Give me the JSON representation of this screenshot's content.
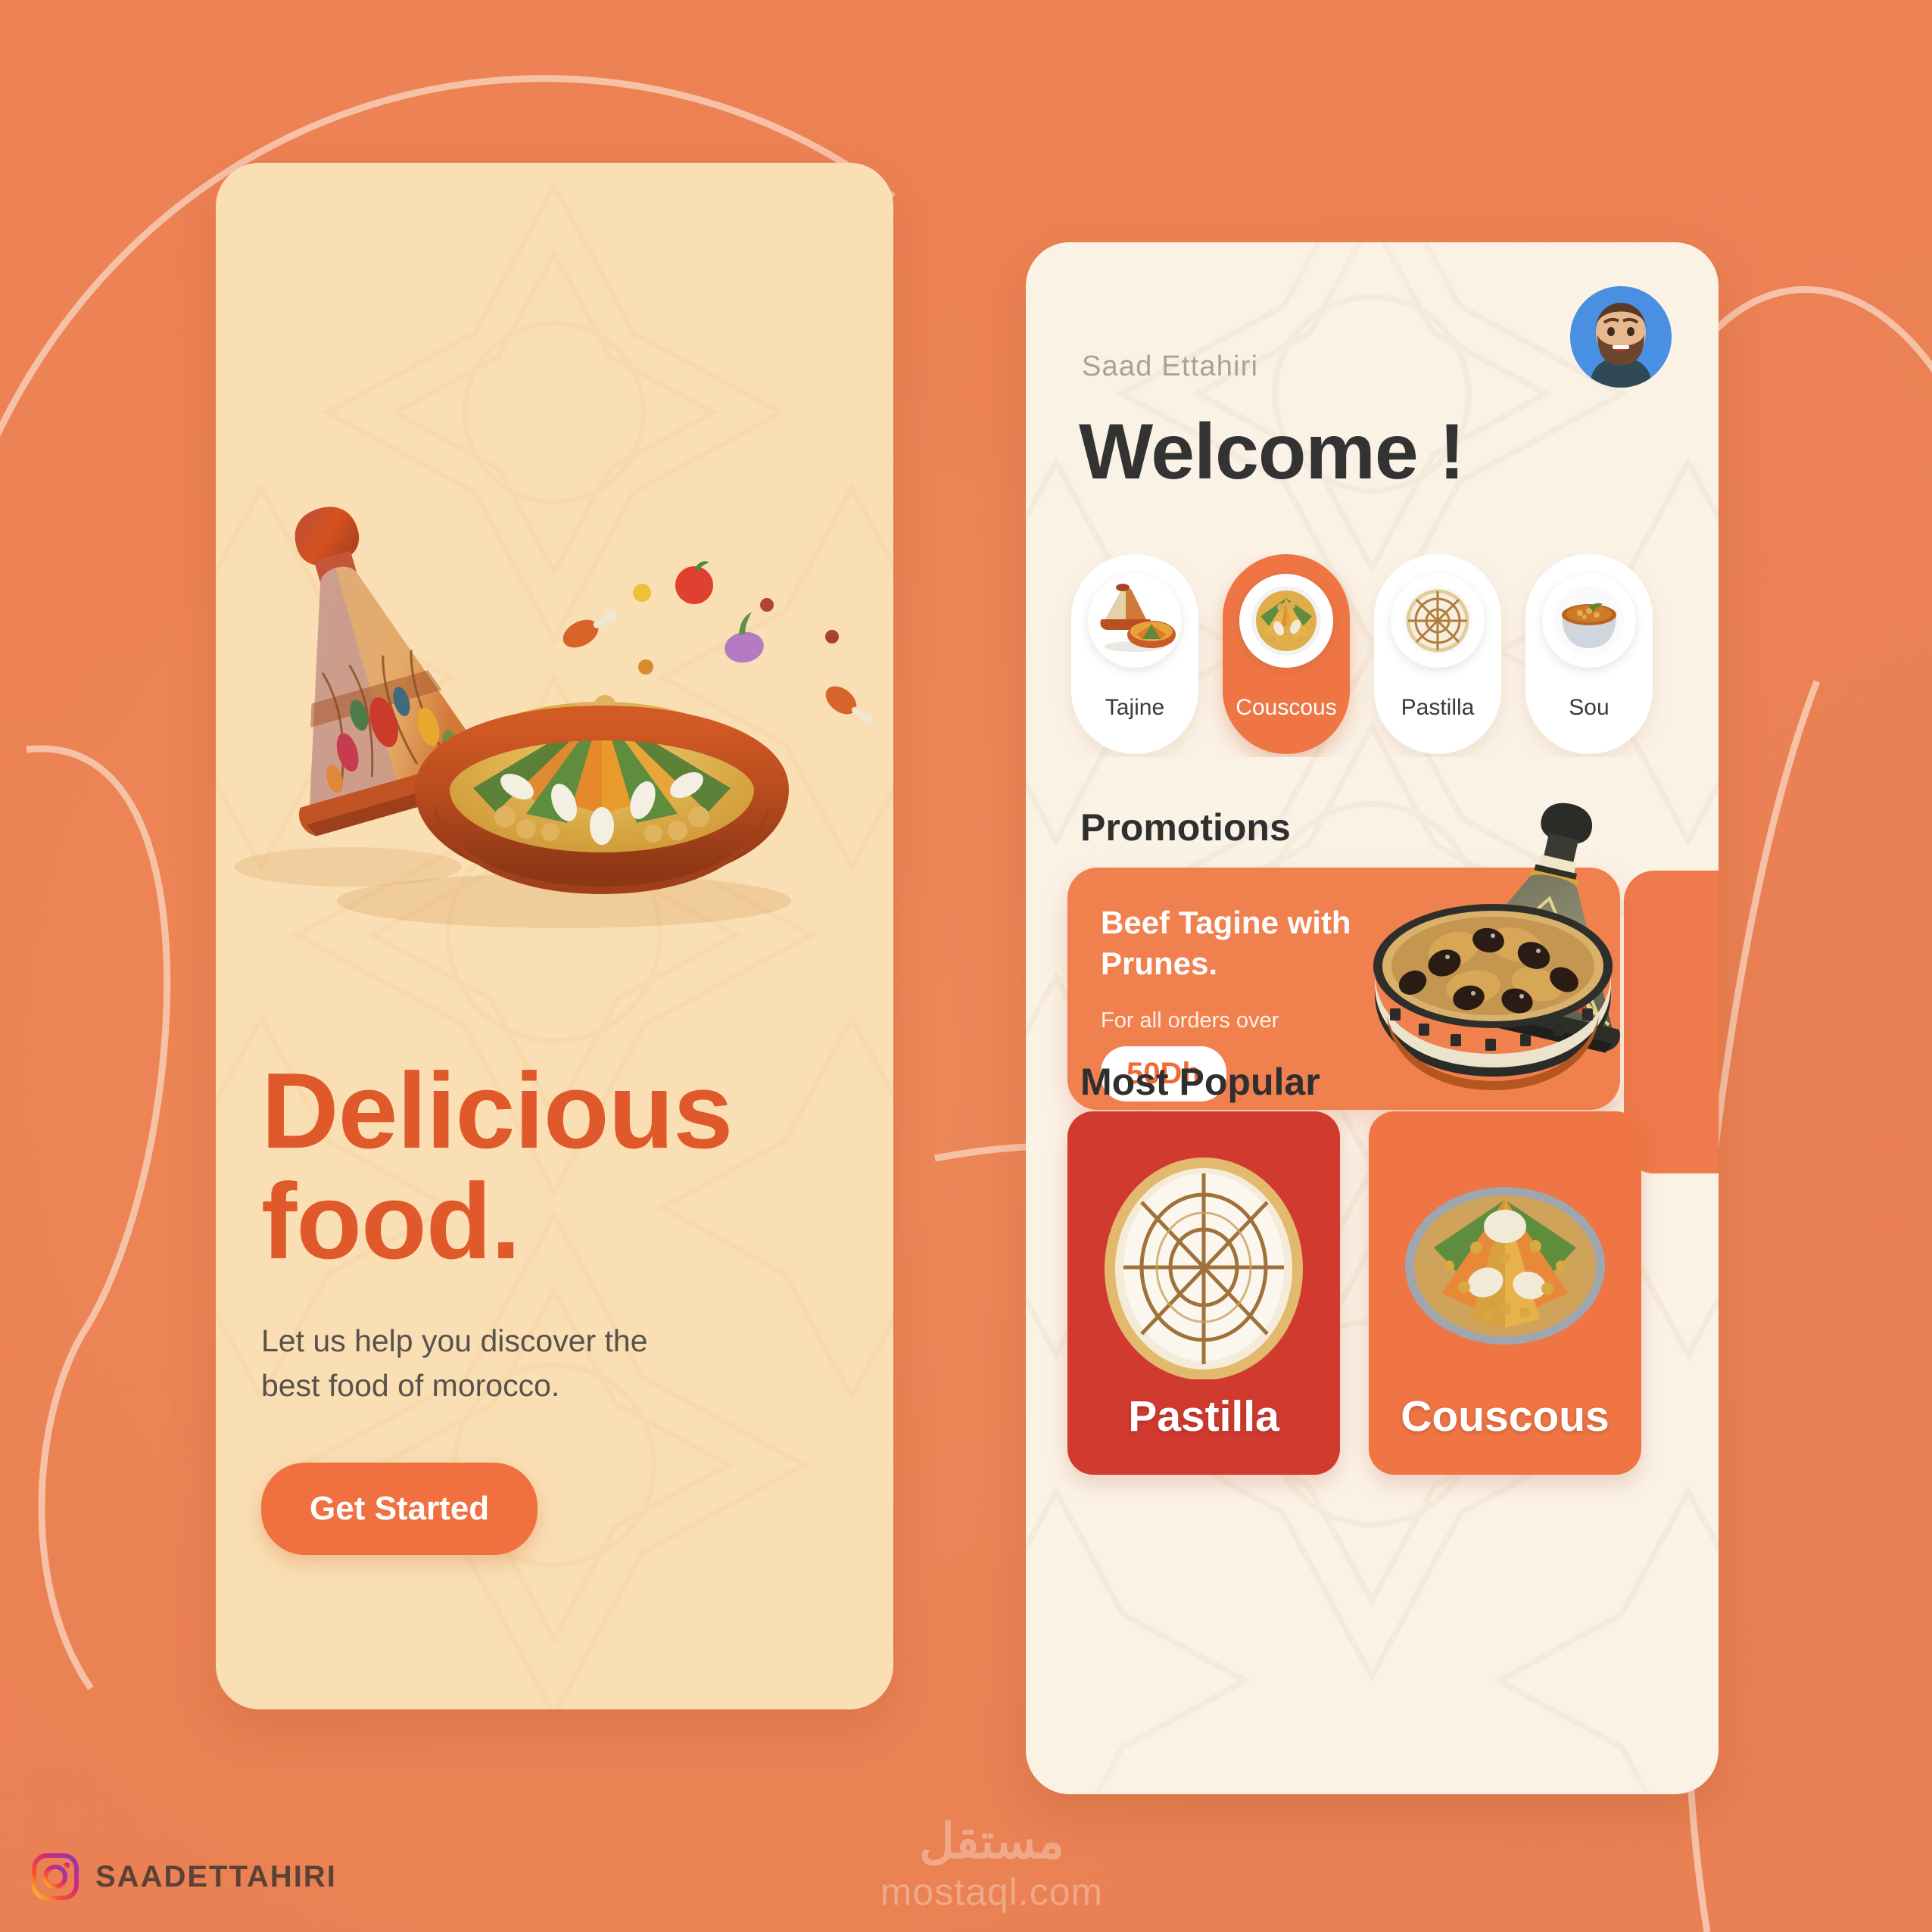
{
  "theme": {
    "background": "#ec8053",
    "accent": "#f0713f",
    "accent_dark": "#e0592a",
    "card_cream": "#fadfb4",
    "card_offwhite": "#fbf2e6",
    "pastilla_red": "#d13b2f",
    "couscous_orange": "#ef7544"
  },
  "onboarding": {
    "headline_line1": "Delicious",
    "headline_line2": "food.",
    "subcopy": "Let us help you discover the best food of morocco.",
    "cta_label": "Get Started",
    "hero_icon": "tagine-illustration"
  },
  "home": {
    "user_name": "Saad Ettahiri",
    "avatar_icon": "user-avatar",
    "welcome_title": "Welcome !",
    "categories": [
      {
        "label": "Tajine",
        "icon": "tajine-dish-icon",
        "selected": false
      },
      {
        "label": "Couscous",
        "icon": "couscous-dish-icon",
        "selected": true
      },
      {
        "label": "Pastilla",
        "icon": "pastilla-dish-icon",
        "selected": false
      },
      {
        "label": "Sou",
        "icon": "soup-bowl-icon",
        "selected": false
      }
    ],
    "promotions": {
      "section_title": "Promotions",
      "title": "Beef Tagine with Prunes.",
      "subtitle": "For all orders over",
      "price_badge": "50Dh",
      "image_icon": "beef-tagine-with-prunes"
    },
    "most_popular": {
      "section_title": "Most Popular",
      "items": [
        {
          "label": "Pastilla",
          "color": "#d13b2f",
          "icon": "pastilla-photo"
        },
        {
          "label": "Couscous",
          "color": "#ef7544",
          "icon": "couscous-photo"
        }
      ]
    }
  },
  "credits": {
    "instagram_icon": "instagram-icon",
    "instagram_handle": "SAADETTAHIRI",
    "watermark_arabic": "مستقل",
    "watermark_domain": "mostaql.com"
  }
}
